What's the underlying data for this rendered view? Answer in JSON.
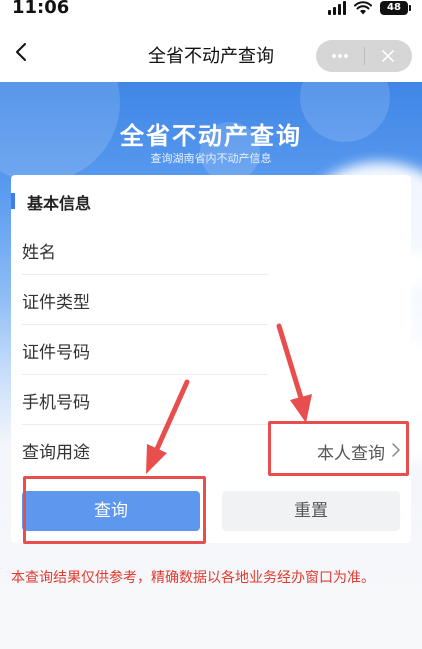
{
  "status_bar": {
    "time": "11:06",
    "battery": "48"
  },
  "nav": {
    "title": "全省不动产查询"
  },
  "banner": {
    "title": "全省不动产查询",
    "subtitle": "查询湖南省内不动产信息"
  },
  "form": {
    "section_title": "基本信息",
    "fields": [
      {
        "label": "姓名"
      },
      {
        "label": "证件类型"
      },
      {
        "label": "证件号码"
      },
      {
        "label": "手机号码"
      }
    ],
    "purpose": {
      "label": "查询用途",
      "value": "本人查询"
    }
  },
  "buttons": {
    "query": "查询",
    "reset": "重置"
  },
  "disclaimer": "本查询结果仅供参考，精确数据以各地业务经办窗口为准。",
  "colors": {
    "primary": "#3d7eea",
    "highlight": "#e84e4e",
    "disclaimer": "#e23a2e"
  },
  "icons": [
    "back-icon",
    "more-icon",
    "close-icon",
    "chevron-right-icon",
    "signal-icon",
    "wifi-icon",
    "battery-icon"
  ]
}
